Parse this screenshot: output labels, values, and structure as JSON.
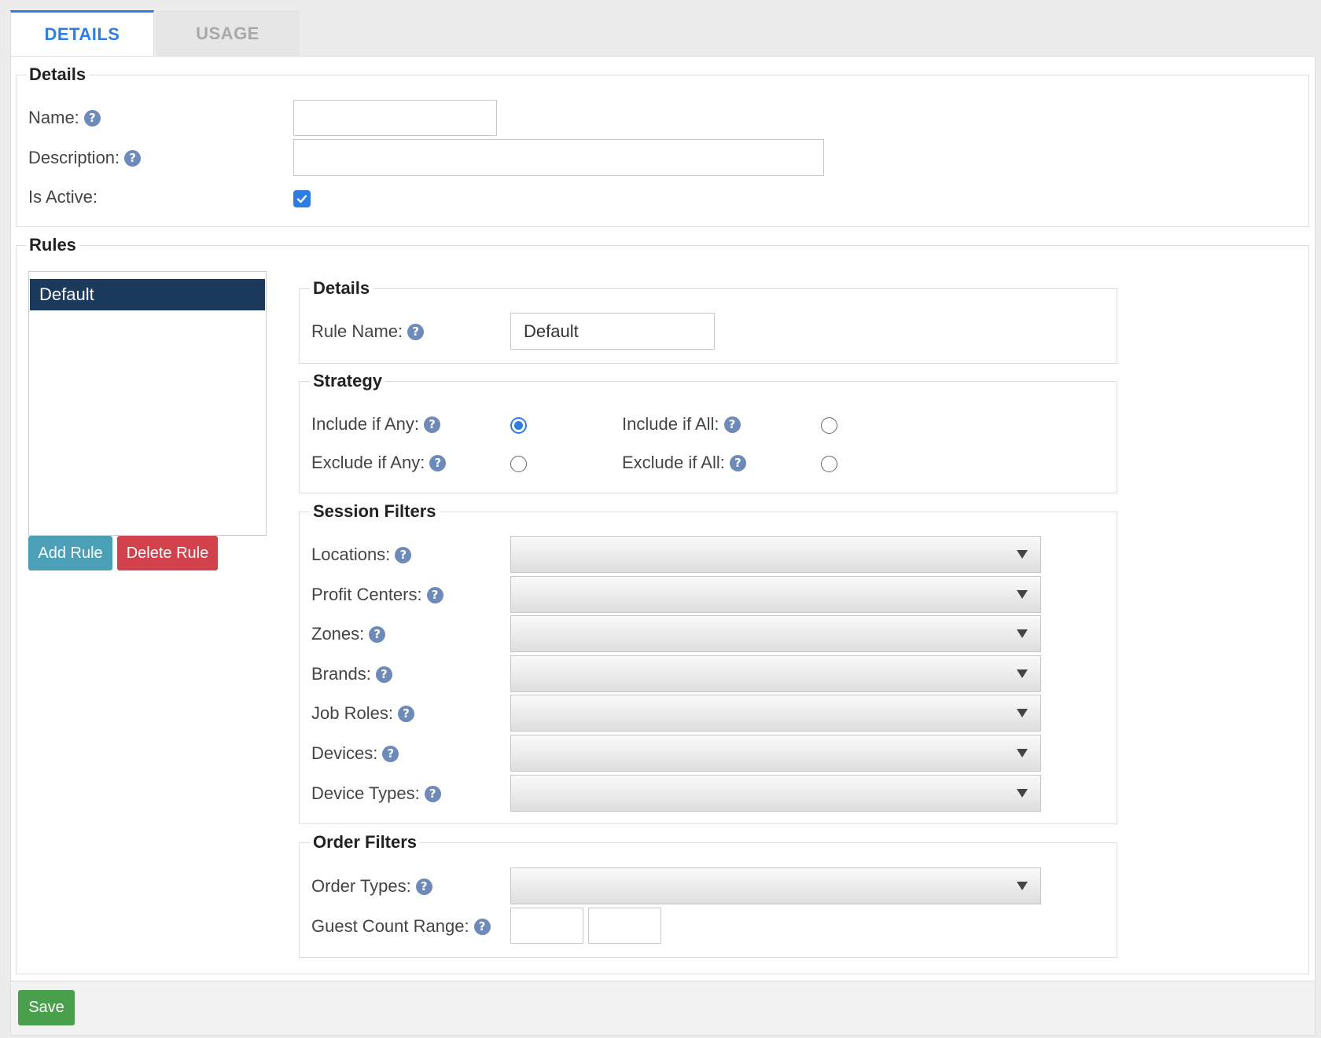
{
  "tabs": {
    "details": "DETAILS",
    "usage": "USAGE"
  },
  "details": {
    "legend": "Details",
    "name_label": "Name:",
    "name_value": "",
    "description_label": "Description:",
    "description_value": "",
    "is_active_label": "Is Active:",
    "is_active_checked": true
  },
  "rules": {
    "legend": "Rules",
    "list": [
      "Default"
    ],
    "selected": "Default",
    "add_label": "Add Rule",
    "delete_label": "Delete Rule"
  },
  "rule_details": {
    "legend": "Details",
    "rule_name_label": "Rule Name:",
    "rule_name_value": "Default"
  },
  "strategy": {
    "legend": "Strategy",
    "include_any": "Include if Any:",
    "include_all": "Include if All:",
    "exclude_any": "Exclude if Any:",
    "exclude_all": "Exclude if All:",
    "selected": "Include if Any:"
  },
  "session_filters": {
    "legend": "Session Filters",
    "locations": "Locations:",
    "profit_centers": "Profit Centers:",
    "zones": "Zones:",
    "brands": "Brands:",
    "job_roles": "Job Roles:",
    "devices": "Devices:",
    "device_types": "Device Types:"
  },
  "order_filters": {
    "legend": "Order Filters",
    "order_types": "Order Types:",
    "guest_count_range": "Guest Count Range:",
    "guest_min": "",
    "guest_max": ""
  },
  "footer": {
    "save_label": "Save"
  },
  "colors": {
    "accent": "#2f7de1",
    "selected_row": "#1b3a5c",
    "add_button": "#4ba0b8",
    "delete_button": "#d2424c",
    "save_button": "#4a9f4c",
    "help_icon": "#6d8ab8"
  },
  "icons": {
    "help": "question-circle-icon",
    "dropdown": "caret-down-icon",
    "check": "check-icon"
  }
}
